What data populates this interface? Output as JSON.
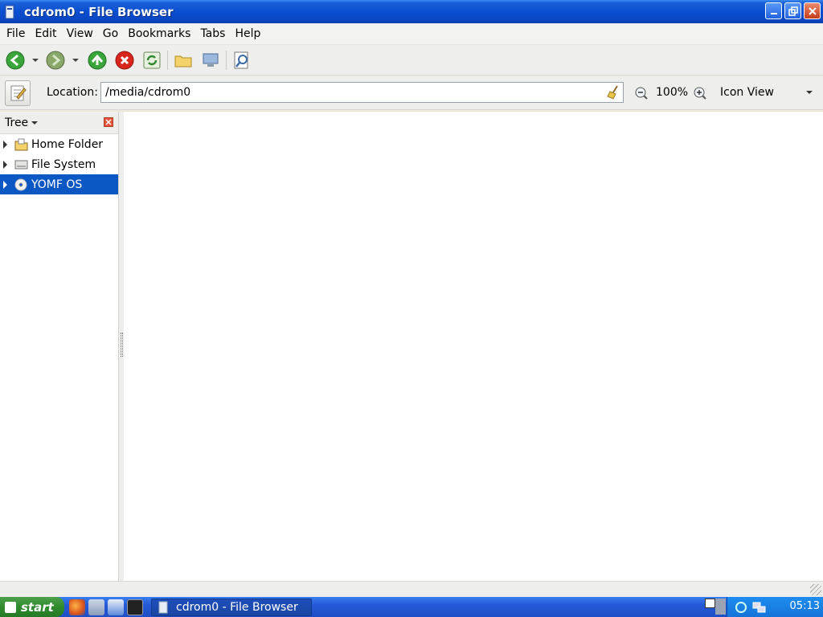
{
  "window": {
    "title": "cdrom0 - File Browser"
  },
  "menubar": {
    "items": [
      {
        "label": "File"
      },
      {
        "label": "Edit"
      },
      {
        "label": "View"
      },
      {
        "label": "Go"
      },
      {
        "label": "Bookmarks"
      },
      {
        "label": "Tabs"
      },
      {
        "label": "Help"
      }
    ]
  },
  "toolbar": {
    "icons": [
      "back-icon",
      "forward-icon",
      "up-icon",
      "stop-icon",
      "reload-icon",
      "home-folder-icon",
      "computer-icon",
      "search-icon"
    ]
  },
  "location": {
    "label": "Location:",
    "value": "/media/cdrom0",
    "zoom": "100%",
    "view_mode": "Icon View"
  },
  "sidebar": {
    "header": "Tree",
    "items": [
      {
        "label": "Home Folder",
        "icon": "home-folder-icon",
        "selected": false
      },
      {
        "label": "File System",
        "icon": "drive-icon",
        "selected": false
      },
      {
        "label": "YOMF OS",
        "icon": "cdrom-icon",
        "selected": true
      }
    ]
  },
  "taskbar": {
    "start_label": "start",
    "task_label": "cdrom0 - File Browser",
    "clock": "05:13"
  },
  "colors": {
    "titlebar": "#0a4fd0",
    "selection": "#0b58c4",
    "taskbar": "#2459d6",
    "start": "#2f8a2e"
  }
}
